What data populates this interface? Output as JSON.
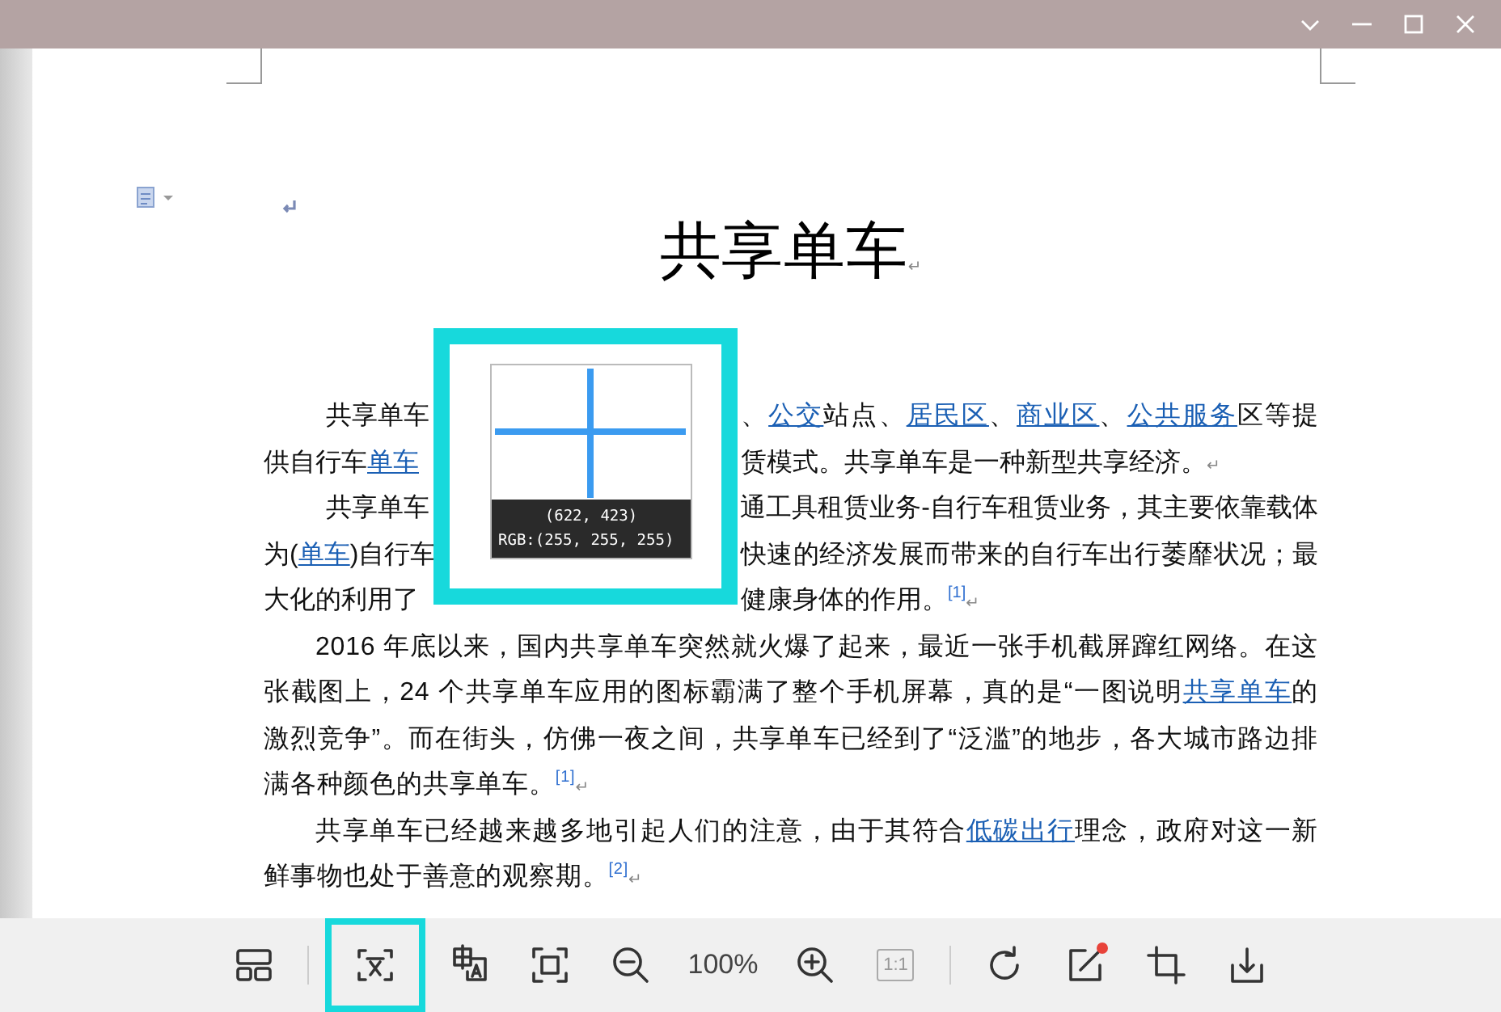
{
  "document": {
    "title": "共享单车",
    "title_mark": "↵",
    "obscured_lines": [
      {
        "indent": true,
        "left": [
          {
            "text": "共享单车"
          }
        ],
        "right": [
          {
            "text": "、"
          },
          {
            "text": "公交",
            "link": true
          },
          {
            "text": "站点、"
          },
          {
            "text": "居民区",
            "link": true
          },
          {
            "text": "、"
          },
          {
            "text": "商业区",
            "link": true
          },
          {
            "text": "、"
          },
          {
            "text": "公共服务",
            "link": true
          },
          {
            "text": "区等提"
          }
        ]
      },
      {
        "indent": false,
        "left": [
          {
            "text": "供自行车"
          },
          {
            "text": "单车",
            "link": true
          }
        ],
        "right": [
          {
            "text": "赁模式。共享单车是一种新型共享经济。"
          }
        ],
        "end_mark": "↵"
      },
      {
        "indent": true,
        "left": [
          {
            "text": "共享单车"
          }
        ],
        "right": [
          {
            "text": "通工具租赁业务-自行车租赁业务，其主要依靠载体"
          }
        ]
      },
      {
        "indent": false,
        "left": [
          {
            "text": "为("
          },
          {
            "text": "单车",
            "link": true
          },
          {
            "text": ")自行车"
          }
        ],
        "right": [
          {
            "text": "快速的经济发展而带来的自行车出行萎靡状况；最"
          }
        ]
      },
      {
        "indent": false,
        "left": [
          {
            "text": "大化的利用了"
          }
        ],
        "right": [
          {
            "text": "健康身体的作用。"
          }
        ],
        "note": "[1]",
        "end_mark": "↵"
      }
    ],
    "paragraphs": [
      {
        "segments": [
          {
            "text": "2016 年底以来，国内共享单车突然就火爆了起来，最近一张手机截屏蹿红网络。在这张截图上，24 个共享单车应用的图标霸满了整个手机屏幕，真的是“一图说明"
          },
          {
            "text": "共享单车",
            "link": true
          },
          {
            "text": "的激烈竞争”。而在街头，仿佛一夜之间，共享单车已经到了“泛滥”的地步，各大城市路边排满各种颜色的共享单车。"
          }
        ],
        "note": "[1]",
        "end_mark": "↵"
      },
      {
        "segments": [
          {
            "text": "共享单车已经越来越多地引起人们的注意，由于其符合"
          },
          {
            "text": "低碳出行",
            "link": true
          },
          {
            "text": "理念，政府对这一新鲜事物也处于善意的观察期。"
          }
        ],
        "note": "[2]",
        "end_mark": "↵"
      }
    ]
  },
  "color_picker": {
    "coordinates": "(622, 423)",
    "rgb": "RGB:(255, 255, 255)"
  },
  "toolbar": [
    {
      "kind": "layout",
      "highlighted": false,
      "disabled": false,
      "badge": false
    },
    {
      "kind": "divider"
    },
    {
      "kind": "ocr",
      "highlighted": true,
      "disabled": false,
      "badge": false
    },
    {
      "kind": "translate",
      "highlighted": false,
      "disabled": false,
      "badge": false
    },
    {
      "kind": "fit",
      "highlighted": false,
      "disabled": false,
      "badge": false
    },
    {
      "kind": "zoom_out",
      "highlighted": false,
      "disabled": false,
      "badge": false
    },
    {
      "kind": "zoom_level",
      "text": "100%",
      "highlighted": false,
      "disabled": false,
      "badge": false
    },
    {
      "kind": "zoom_in",
      "highlighted": false,
      "disabled": false,
      "badge": false
    },
    {
      "kind": "actual_size",
      "text": "1:1",
      "highlighted": false,
      "disabled": true,
      "badge": false
    },
    {
      "kind": "divider"
    },
    {
      "kind": "rotate",
      "highlighted": false,
      "disabled": false,
      "badge": false
    },
    {
      "kind": "edit",
      "highlighted": false,
      "disabled": false,
      "badge": true
    },
    {
      "kind": "crop",
      "highlighted": false,
      "disabled": false,
      "badge": false
    },
    {
      "kind": "save",
      "highlighted": false,
      "disabled": false,
      "badge": false
    }
  ]
}
